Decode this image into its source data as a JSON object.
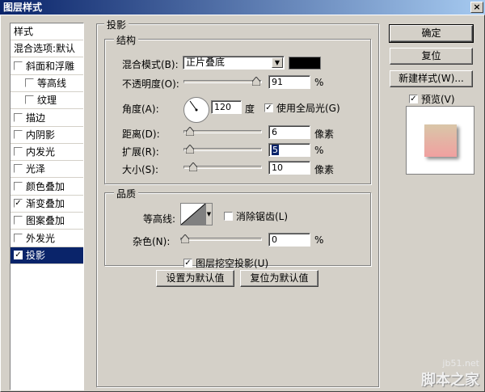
{
  "window": {
    "title": "图层样式",
    "close": "×"
  },
  "sidebar": {
    "items": [
      {
        "label": "样式",
        "checked": false,
        "has_cb": false,
        "indent": false
      },
      {
        "label": "混合选项:默认",
        "checked": false,
        "has_cb": false,
        "indent": false
      },
      {
        "label": "斜面和浮雕",
        "checked": false,
        "has_cb": true,
        "indent": false
      },
      {
        "label": "等高线",
        "checked": false,
        "has_cb": true,
        "indent": true
      },
      {
        "label": "纹理",
        "checked": false,
        "has_cb": true,
        "indent": true
      },
      {
        "label": "描边",
        "checked": false,
        "has_cb": true,
        "indent": false
      },
      {
        "label": "内阴影",
        "checked": false,
        "has_cb": true,
        "indent": false
      },
      {
        "label": "内发光",
        "checked": false,
        "has_cb": true,
        "indent": false
      },
      {
        "label": "光泽",
        "checked": false,
        "has_cb": true,
        "indent": false
      },
      {
        "label": "颜色叠加",
        "checked": false,
        "has_cb": true,
        "indent": false
      },
      {
        "label": "渐变叠加",
        "checked": true,
        "has_cb": true,
        "indent": false
      },
      {
        "label": "图案叠加",
        "checked": false,
        "has_cb": true,
        "indent": false
      },
      {
        "label": "外发光",
        "checked": false,
        "has_cb": true,
        "indent": false
      },
      {
        "label": "投影",
        "checked": true,
        "has_cb": true,
        "indent": false
      }
    ],
    "selected_index": 13
  },
  "panel": {
    "title": "投影",
    "structure": {
      "title": "结构",
      "blend_mode_label": "混合模式(B):",
      "blend_mode_value": "正片叠底",
      "shadow_color": "#000000",
      "opacity_label": "不透明度(O):",
      "opacity_value": "91",
      "opacity_unit": "%",
      "angle_label": "角度(A):",
      "angle_value": "120",
      "angle_unit": "度",
      "global_light_label": "使用全局光(G)",
      "global_light_checked": true,
      "distance_label": "距离(D):",
      "distance_value": "6",
      "distance_unit": "像素",
      "spread_label": "扩展(R):",
      "spread_value": "5",
      "spread_unit": "%",
      "size_label": "大小(S):",
      "size_value": "10",
      "size_unit": "像素"
    },
    "quality": {
      "title": "品质",
      "contour_label": "等高线:",
      "antialias_label": "消除锯齿(L)",
      "antialias_checked": false,
      "noise_label": "杂色(N):",
      "noise_value": "0",
      "noise_unit": "%"
    },
    "knockout_label": "图层挖空投影(U)",
    "knockout_checked": true,
    "make_default": "设置为默认值",
    "reset_default": "复位为默认值"
  },
  "buttons": {
    "ok": "确定",
    "reset": "复位",
    "new_style": "新建样式(W)...",
    "preview_label": "预览(V)",
    "preview_checked": true
  },
  "watermark": {
    "line1": "jb51.net",
    "line2": "脚本之家"
  },
  "check_glyph": "✓",
  "arrow_glyph": "▼"
}
